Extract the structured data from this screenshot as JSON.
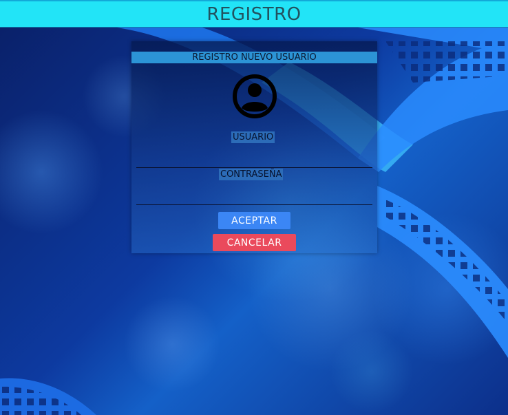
{
  "window": {
    "title": "REGISTRO"
  },
  "form": {
    "header": "REGISTRO NUEVO USUARIO",
    "username_label": "USUARIO",
    "username_value": "",
    "password_label": "CONTRASEÑA",
    "password_value": "",
    "accept_label": "ACEPTAR",
    "cancel_label": "CANCELAR"
  },
  "icons": {
    "avatar": "user-avatar-icon"
  },
  "colors": {
    "title_bar": "#22e4f7",
    "title_text": "#22525f",
    "panel_header": "#2c94d6",
    "accept_button": "#3b86f5",
    "cancel_button": "#ea4a5c"
  }
}
